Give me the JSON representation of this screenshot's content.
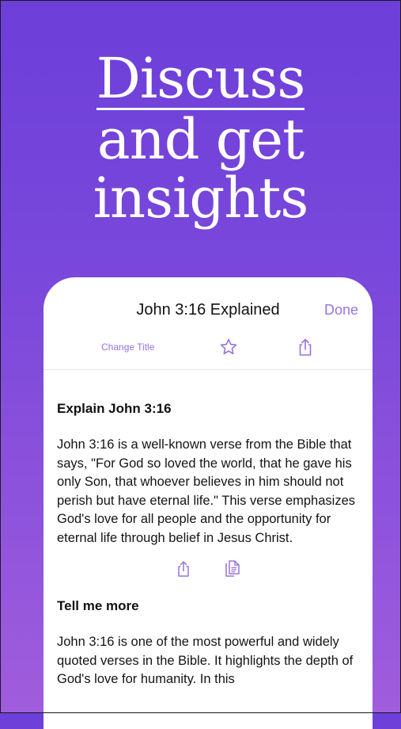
{
  "headline": {
    "line1": "Discuss",
    "line2": "and get",
    "line3": "insights"
  },
  "sheet": {
    "title": "John 3:16 Explained",
    "done_label": "Done",
    "change_title_label": "Change Title",
    "icons": {
      "favorite": "star-icon",
      "share": "share-icon",
      "copy": "copy-icon"
    }
  },
  "conversation": [
    {
      "question": "Explain John 3:16",
      "answer": "John 3:16 is a well-known verse from the Bible that says, \"For God so loved the world, that he gave his only Son, that whoever believes in him should not perish but have eternal life.\" This verse emphasizes God's love for all people and the opportunity for eternal life through belief in Jesus Christ."
    },
    {
      "question": "Tell me more",
      "answer": "John 3:16 is one of the most powerful and widely quoted verses in the Bible. It highlights the depth of God's love for humanity. In this"
    }
  ],
  "colors": {
    "accent": "#9a72e0",
    "background_top": "#6d3fd9",
    "background_bottom": "#a05ddc"
  }
}
